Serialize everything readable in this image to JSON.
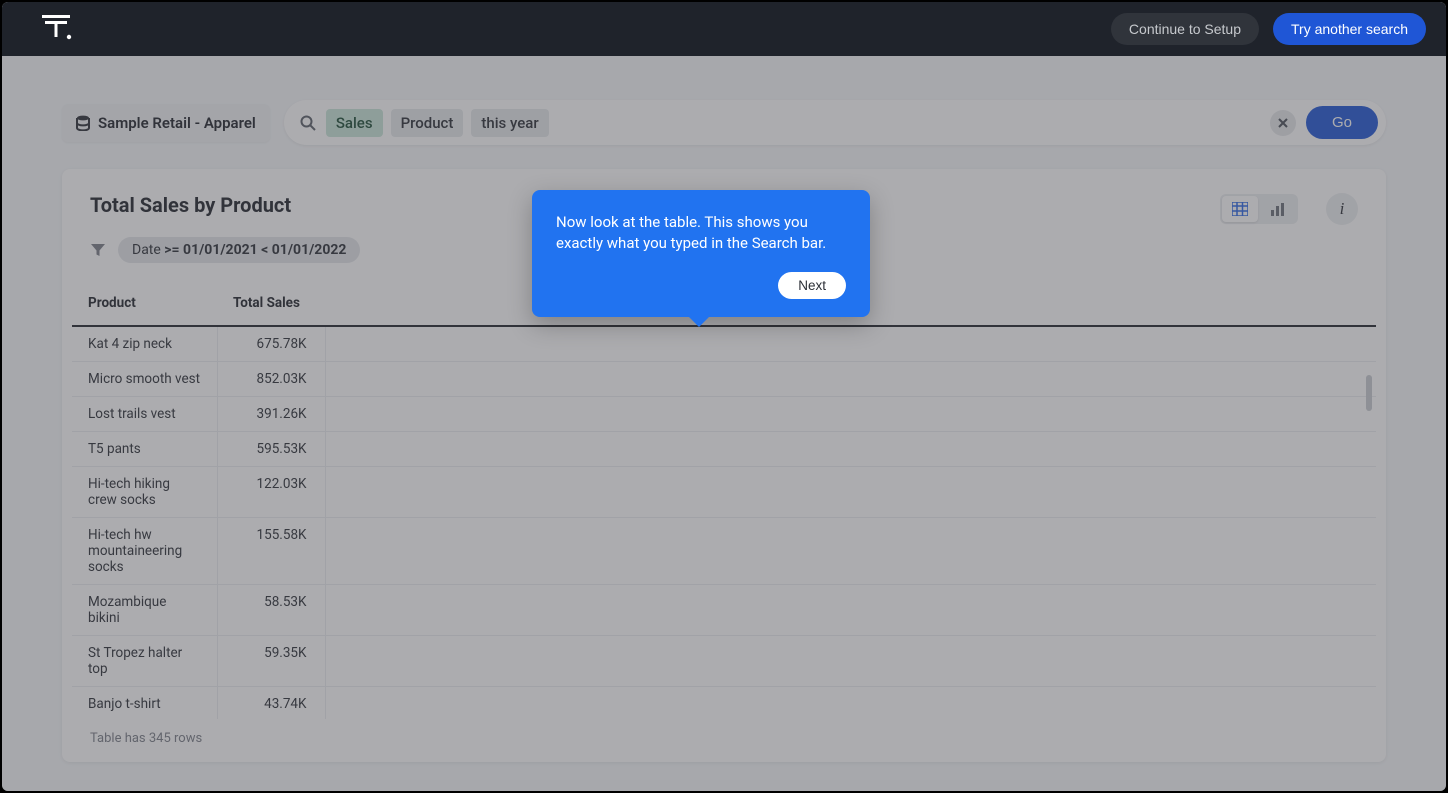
{
  "header": {
    "continue_label": "Continue to Setup",
    "try_another_label": "Try another search"
  },
  "source": {
    "name": "Sample Retail - Apparel"
  },
  "search": {
    "tokens": [
      "Sales",
      "Product",
      "this year"
    ],
    "go_label": "Go"
  },
  "report": {
    "title": "Total Sales by Product",
    "filter_prefix": "Date",
    "filter_expression": ">= 01/01/2021 < 01/01/2022",
    "columns": [
      "Product",
      "Total Sales"
    ],
    "rows": [
      {
        "product": "Kat 4 zip neck",
        "total_sales": "675.78K"
      },
      {
        "product": "Micro smooth vest",
        "total_sales": "852.03K"
      },
      {
        "product": "Lost trails vest",
        "total_sales": "391.26K"
      },
      {
        "product": "T5 pants",
        "total_sales": "595.53K"
      },
      {
        "product": "Hi-tech hiking crew socks",
        "total_sales": "122.03K"
      },
      {
        "product": "Hi-tech hw mountaineering socks",
        "total_sales": "155.58K"
      },
      {
        "product": "Mozambique bikini",
        "total_sales": "58.53K"
      },
      {
        "product": "St Tropez halter top",
        "total_sales": "59.35K"
      },
      {
        "product": "Banjo t-shirt",
        "total_sales": "43.74K"
      }
    ],
    "footer": "Table has 345 rows"
  },
  "popover": {
    "text": "Now look at the table. This shows you exactly what you typed in the Search bar.",
    "next_label": "Next"
  },
  "chart_data": {
    "type": "table",
    "title": "Total Sales by Product",
    "columns": [
      "Product",
      "Total Sales"
    ],
    "rows": [
      [
        "Kat 4 zip neck",
        "675.78K"
      ],
      [
        "Micro smooth vest",
        "852.03K"
      ],
      [
        "Lost trails vest",
        "391.26K"
      ],
      [
        "T5 pants",
        "595.53K"
      ],
      [
        "Hi-tech hiking crew socks",
        "122.03K"
      ],
      [
        "Hi-tech hw mountaineering socks",
        "155.58K"
      ],
      [
        "Mozambique bikini",
        "58.53K"
      ],
      [
        "St Tropez halter top",
        "59.35K"
      ],
      [
        "Banjo t-shirt",
        "43.74K"
      ]
    ],
    "total_row_count": 345
  }
}
